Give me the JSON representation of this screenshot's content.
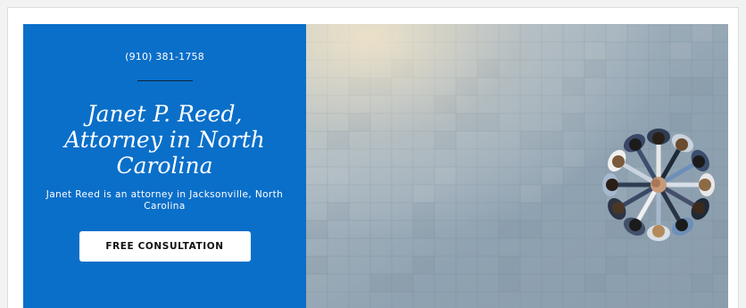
{
  "hero": {
    "phone": "(910) 381-1758",
    "headline": "Janet P. Reed, Attorney in North Carolina",
    "subheadline": "Janet Reed is an attorney in Jacksonville, North Carolina",
    "cta_label": "FREE CONSULTATION"
  },
  "colors": {
    "panel": "#0a6fc9",
    "rule": "#0b2340",
    "button_bg": "#ffffff"
  },
  "image": {
    "subject": "team-hands-together-photo"
  }
}
